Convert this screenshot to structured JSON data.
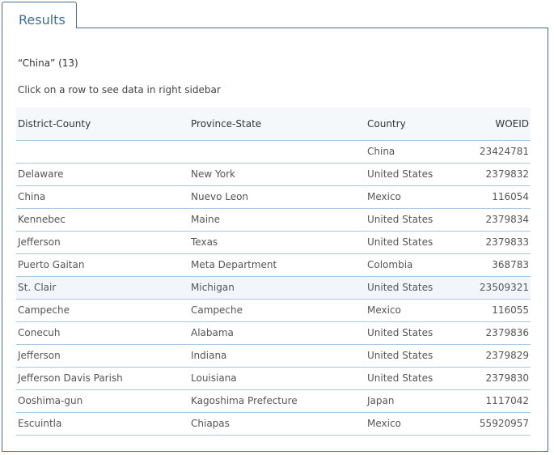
{
  "tab": {
    "label": "Results"
  },
  "results": {
    "heading": "“China” (13)",
    "hint": "Click on a row to see data in right sidebar",
    "columns": [
      "District-County",
      "Province-State",
      "Country",
      "WOEID"
    ],
    "rows": [
      {
        "district": "",
        "province": "",
        "country": "China",
        "woeid": "23424781"
      },
      {
        "district": "Delaware",
        "province": "New York",
        "country": "United States",
        "woeid": "2379832"
      },
      {
        "district": "China",
        "province": "Nuevo Leon",
        "country": "Mexico",
        "woeid": "116054"
      },
      {
        "district": "Kennebec",
        "province": "Maine",
        "country": "United States",
        "woeid": "2379834"
      },
      {
        "district": "Jefferson",
        "province": "Texas",
        "country": "United States",
        "woeid": "2379833"
      },
      {
        "district": "Puerto Gaitan",
        "province": "Meta Department",
        "country": "Colombia",
        "woeid": "368783"
      },
      {
        "district": "St. Clair",
        "province": "Michigan",
        "country": "United States",
        "woeid": "23509321"
      },
      {
        "district": "Campeche",
        "province": "Campeche",
        "country": "Mexico",
        "woeid": "116055"
      },
      {
        "district": "Conecuh",
        "province": "Alabama",
        "country": "United States",
        "woeid": "2379836"
      },
      {
        "district": "Jefferson",
        "province": "Indiana",
        "country": "United States",
        "woeid": "2379829"
      },
      {
        "district": "Jefferson Davis Parish",
        "province": "Louisiana",
        "country": "United States",
        "woeid": "2379830"
      },
      {
        "district": "Ooshima-gun",
        "province": "Kagoshima Prefecture",
        "country": "Japan",
        "woeid": "1117042"
      },
      {
        "district": "Escuintla",
        "province": "Chiapas",
        "country": "Mexico",
        "woeid": "55920957"
      }
    ]
  },
  "colors": {
    "accent": "#3f6f93",
    "row_border": "#a9c8de",
    "header_bg": "#f5f8fb"
  }
}
